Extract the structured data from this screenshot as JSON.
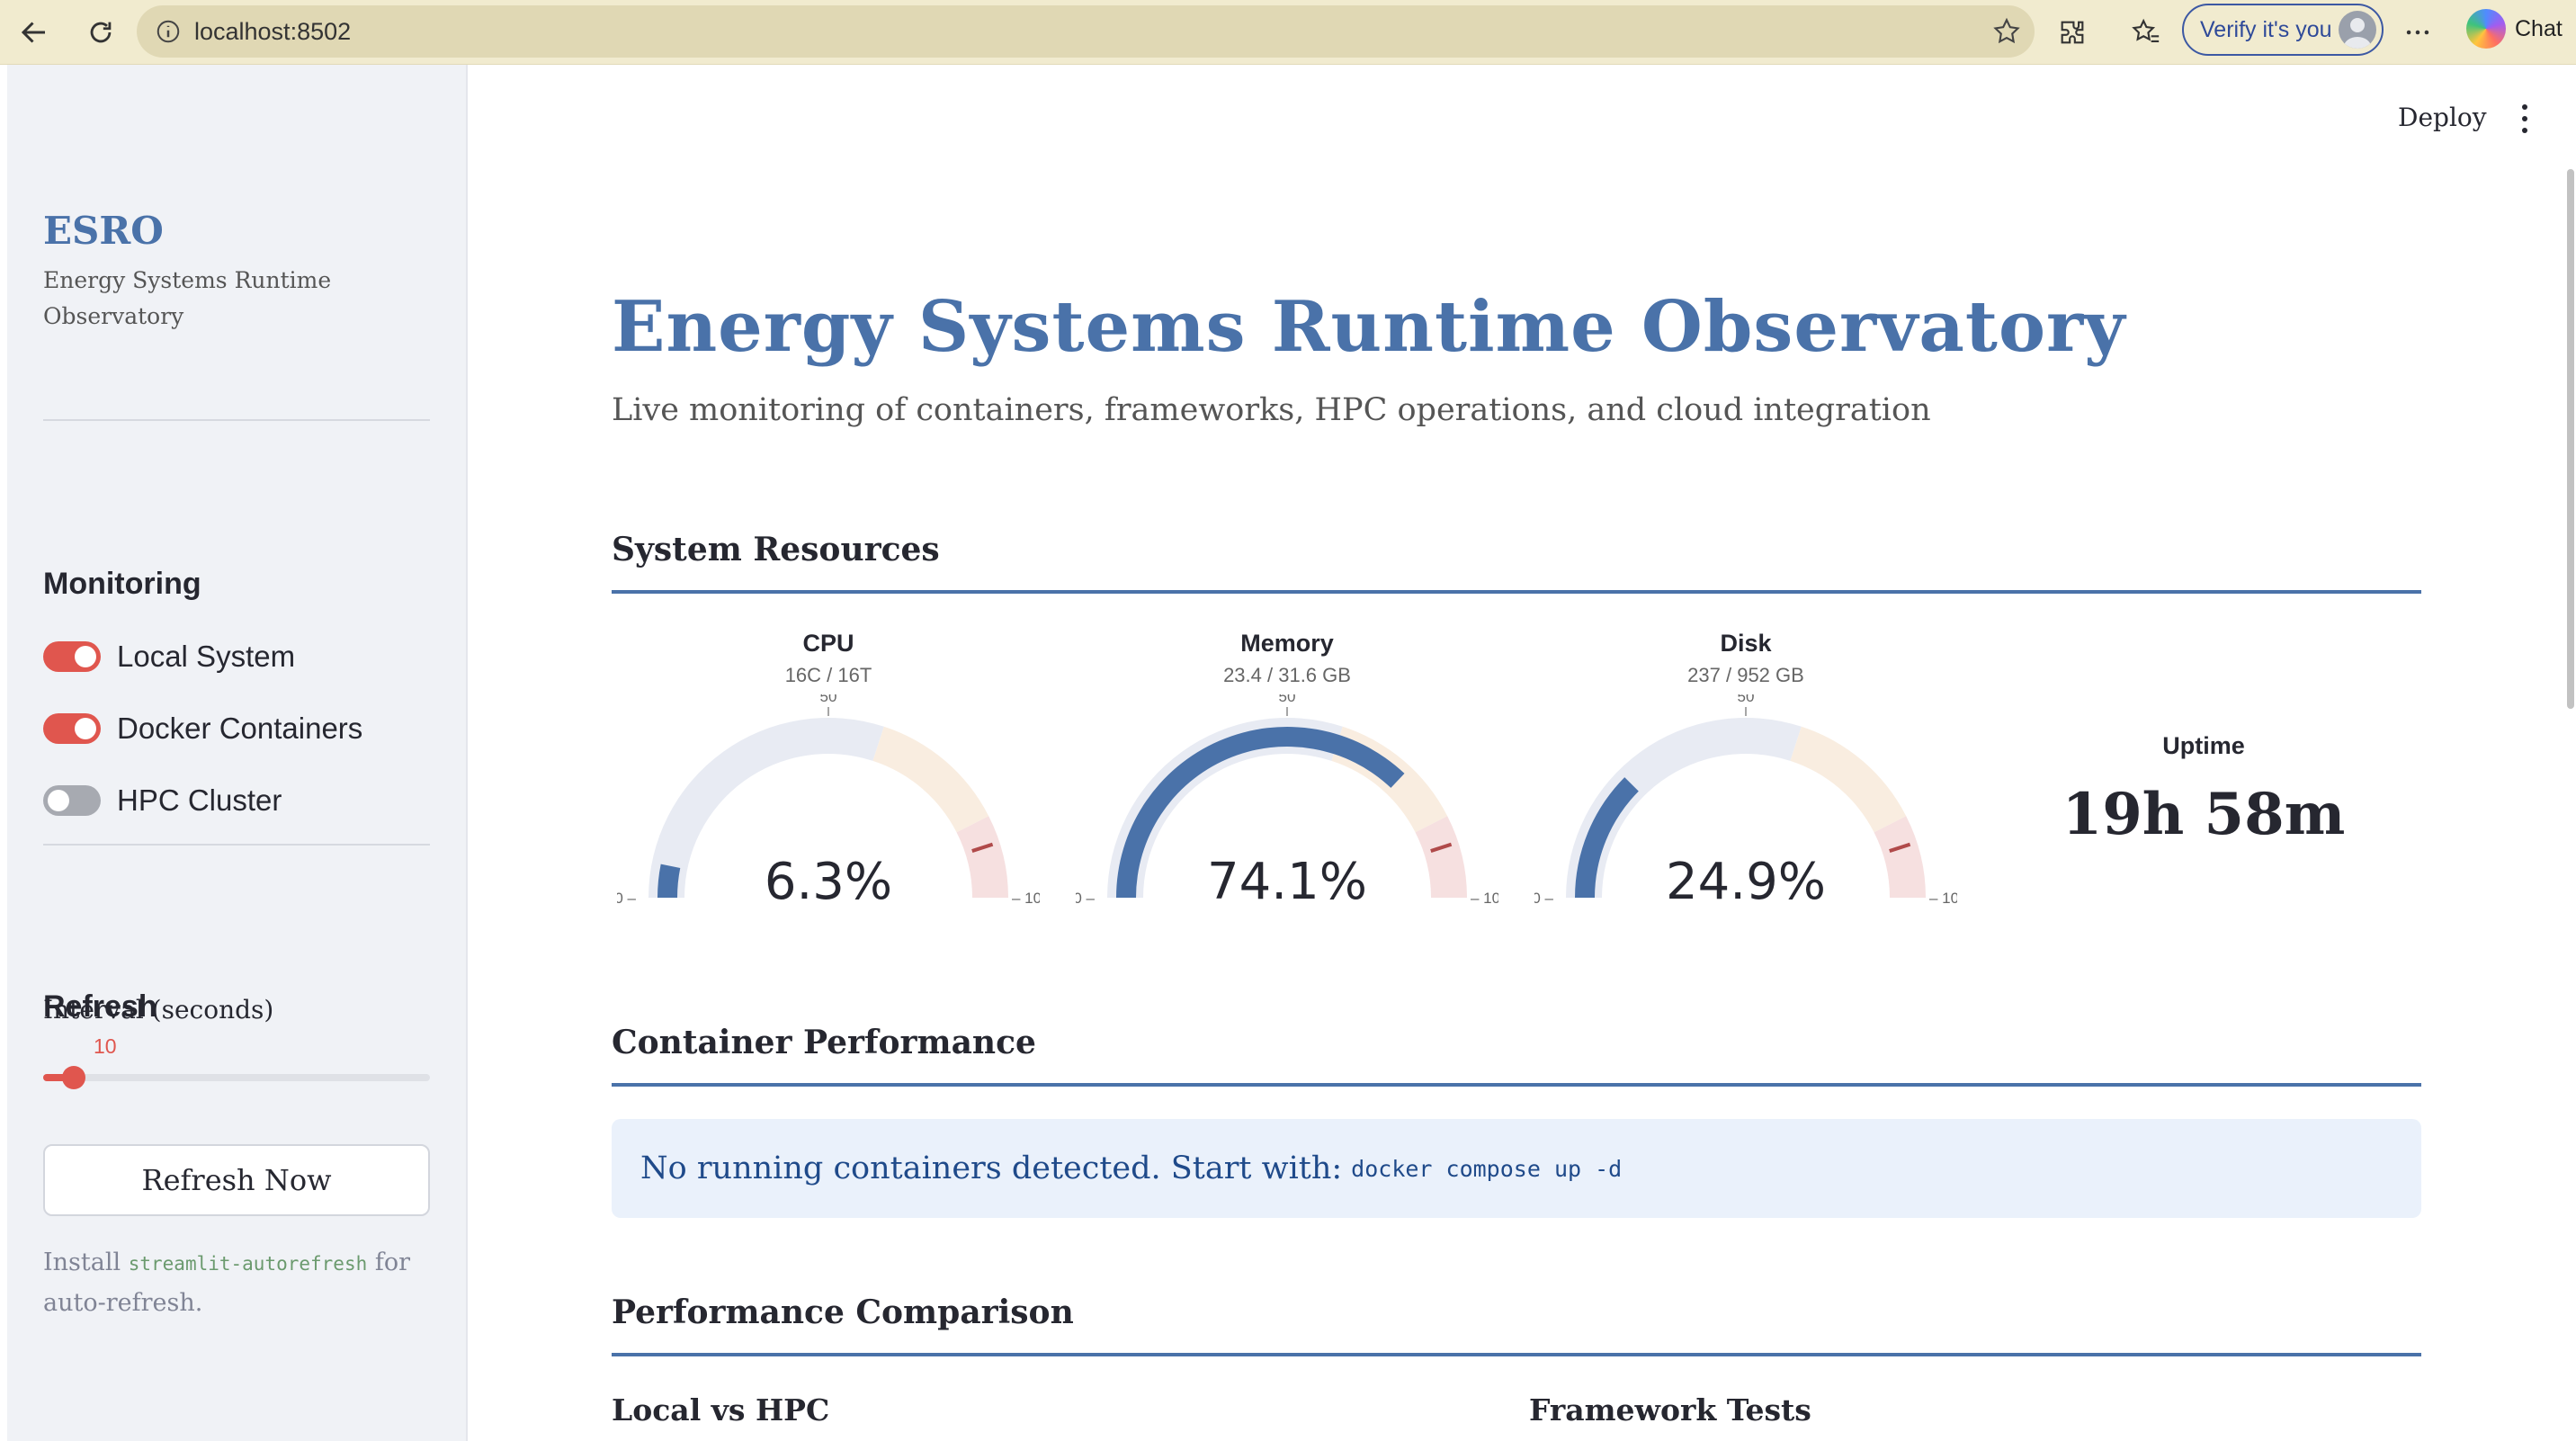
{
  "browser": {
    "url": "localhost:8502",
    "verify_label": "Verify it's you",
    "chat_label": "Chat"
  },
  "sidebar": {
    "brand": "ESRO",
    "brand_subtitle": "Energy Systems Runtime Observatory",
    "monitoring_heading": "Monitoring",
    "toggles": [
      {
        "label": "Local System",
        "on": true
      },
      {
        "label": "Docker Containers",
        "on": true
      },
      {
        "label": "HPC Cluster",
        "on": false
      }
    ],
    "refresh_heading": "Refresh",
    "interval_label": "Interval (seconds)",
    "interval_value": "10",
    "interval_fraction": 0.08,
    "refresh_button": "Refresh Now",
    "install_prefix": "Install",
    "install_code": "streamlit-autorefresh",
    "install_suffix": "for auto-refresh."
  },
  "header": {
    "deploy_label": "Deploy"
  },
  "main": {
    "title": "Energy Systems Runtime Observatory",
    "subtitle": "Live monitoring of containers, frameworks, HPC operations, and cloud integration",
    "system_resources_heading": "System Resources",
    "gauges": [
      {
        "title": "CPU",
        "subtitle": "16C / 16T",
        "value": 6.3,
        "value_label": "6.3%"
      },
      {
        "title": "Memory",
        "subtitle": "23.4 / 31.6 GB",
        "value": 74.1,
        "value_label": "74.1%"
      },
      {
        "title": "Disk",
        "subtitle": "237 / 952 GB",
        "value": 24.9,
        "value_label": "24.9%"
      }
    ],
    "gauge_ticks": {
      "min": "0",
      "mid": "50",
      "max": "100"
    },
    "gauge_bands": {
      "normal_end": 60,
      "warning_end": 85,
      "threshold": 90
    },
    "colors": {
      "accent": "#4a72a9",
      "band_normal": "#e8ebf3",
      "band_warning": "#f9ede0",
      "band_critical": "#f6e0e0",
      "threshold": "#b04a4a",
      "toggle_on": "#e0564e"
    },
    "uptime_label": "Uptime",
    "uptime_value": "19h 58m",
    "container_heading": "Container Performance",
    "container_alert_text": "No running containers detected. Start with:",
    "container_alert_code": "docker compose up -d",
    "performance_heading": "Performance Comparison",
    "local_vs_hpc": "Local vs HPC",
    "framework_tests": "Framework Tests"
  }
}
